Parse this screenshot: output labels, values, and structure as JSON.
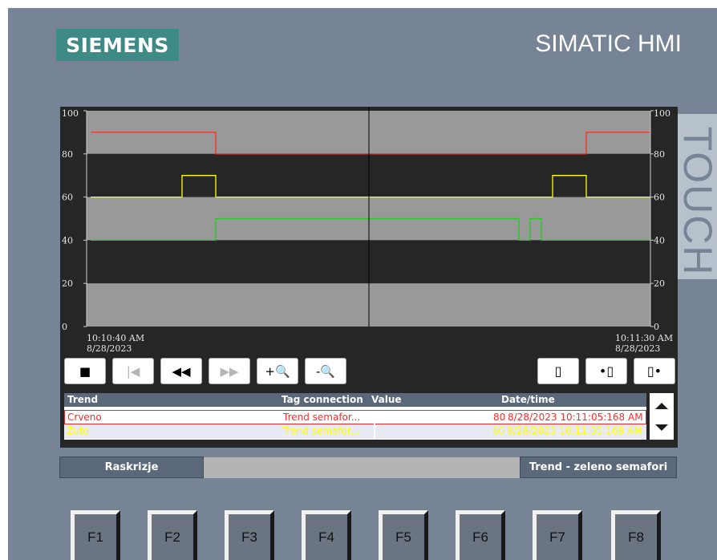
{
  "device": {
    "brand": "SIEMENS",
    "title": "SIMATIC HMI",
    "touch_label": "TOUCH"
  },
  "trend_view": {
    "y_axis": {
      "ticks": [
        "100",
        "80",
        "60",
        "40",
        "20",
        "0"
      ],
      "min": 0,
      "max": 100
    },
    "time_start": {
      "time": "10:10:40 AM",
      "date": "8/28/2023"
    },
    "time_end": {
      "time": "10:11:30 AM",
      "date": "8/28/2023"
    },
    "colors": {
      "crveno": "#ff2a2a",
      "zuto": "#ffff00",
      "zeleno": "#22cc22",
      "band_light": "#999999",
      "band_dark": "#262626"
    }
  },
  "toolbar": {
    "left": [
      {
        "name": "stop-button",
        "icon": "stop-icon",
        "glyph": "■",
        "enabled": true
      },
      {
        "name": "to-start-button",
        "icon": "skip-to-start-icon",
        "glyph": "|◀",
        "enabled": false
      },
      {
        "name": "scroll-back-button",
        "icon": "rewind-icon",
        "glyph": "◀◀",
        "enabled": true
      },
      {
        "name": "scroll-forward-button",
        "icon": "fast-forward-icon",
        "glyph": "▶▶",
        "enabled": false
      },
      {
        "name": "zoom-in-button",
        "icon": "zoom-in-icon",
        "glyph": "+🔍",
        "enabled": true
      },
      {
        "name": "zoom-out-button",
        "icon": "zoom-out-icon",
        "glyph": "-🔍",
        "enabled": true
      }
    ],
    "right": [
      {
        "name": "ruler-button",
        "icon": "ruler-icon",
        "glyph": "▯",
        "enabled": true
      },
      {
        "name": "ruler-back-button",
        "icon": "ruler-back-icon",
        "glyph": "•▯",
        "enabled": true
      },
      {
        "name": "ruler-forward-button",
        "icon": "ruler-forward-icon",
        "glyph": "▯•",
        "enabled": true
      }
    ]
  },
  "value_table": {
    "headers": {
      "trend": "Trend",
      "tag": "Tag connection",
      "value": "Value",
      "datetime": "Date/time"
    },
    "rows": [
      {
        "trend": "Crveno",
        "tag": "Trend semafor...",
        "value": "80",
        "datetime": "8/28/2023 10:11:05:168 AM",
        "color": "#ff2a2a"
      },
      {
        "trend": "Zuto",
        "tag": "Trend semafor...",
        "value": "60",
        "datetime": "8/28/2023 10:11:05:168 AM",
        "color": "#ffff00"
      }
    ]
  },
  "nav": {
    "left_label": "Raskrizje",
    "right_label": "Trend - zeleno semafori"
  },
  "function_keys": [
    "F1",
    "F2",
    "F3",
    "F4",
    "F5",
    "F6",
    "F7",
    "F8"
  ]
}
